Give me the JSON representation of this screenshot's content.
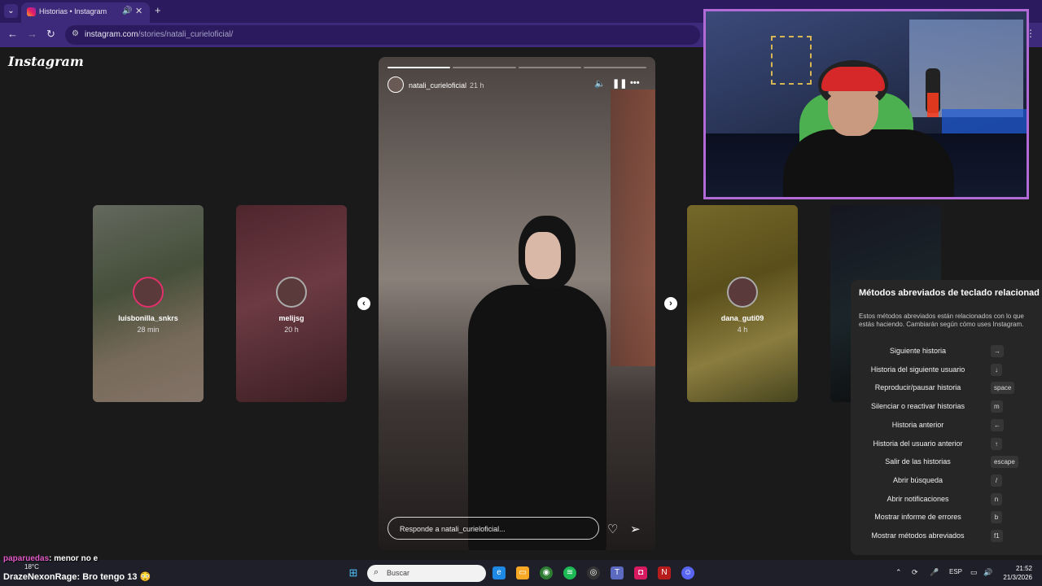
{
  "browser": {
    "tab_title": "Historias • Instagram",
    "url_host": "instagram.com",
    "url_path": "/stories/natali_curieloficial/"
  },
  "instagram": {
    "logo": "Instagram",
    "side_stories": [
      {
        "name": "luisbonilla_snkrs",
        "time": "28 min"
      },
      {
        "name": "melijsg",
        "time": "20 h"
      },
      {
        "name": "dana_guti09",
        "time": "4 h"
      }
    ],
    "story": {
      "username": "natali_curieloficial",
      "time": "21 h",
      "reply_placeholder": "Responde a natali_curieloficial...",
      "progress_segments": 4,
      "progress_current": 1
    }
  },
  "shortcuts_panel": {
    "title": "Métodos abreviados de teclado relacionad",
    "description": "Estos métodos abreviados están relacionados con lo que estás haciendo. Cambiarán según cómo uses Instagram.",
    "items": [
      {
        "label": "Siguiente historia",
        "key": "→"
      },
      {
        "label": "Historia del siguiente usuario",
        "key": "↓"
      },
      {
        "label": "Reproducir/pausar historia",
        "key": "space"
      },
      {
        "label": "Silenciar o reactivar historias",
        "key": "m"
      },
      {
        "label": "Historia anterior",
        "key": "←"
      },
      {
        "label": "Historia del usuario anterior",
        "key": "↑"
      },
      {
        "label": "Salir de las historias",
        "key": "escape"
      },
      {
        "label": "Abrir búsqueda",
        "key": "/"
      },
      {
        "label": "Abrir notificaciones",
        "key": "n"
      },
      {
        "label": "Mostrar informe de errores",
        "key": "b"
      },
      {
        "label": "Mostrar métodos abreviados",
        "key": "f1"
      }
    ]
  },
  "stream_chat": [
    {
      "user": "paparuedas",
      "message": ": menor no e"
    },
    {
      "user": "DrazeNexonRage",
      "message": ": Bro tengo 13 😳"
    }
  ],
  "taskbar": {
    "search_placeholder": "Buscar",
    "weather": "18°C",
    "language": "ESP",
    "time": "21:52",
    "date": "21/3/2026"
  }
}
